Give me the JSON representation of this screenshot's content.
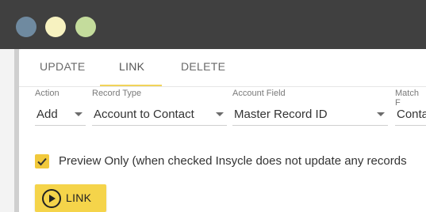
{
  "tabs": [
    {
      "label": "UPDATE"
    },
    {
      "label": "LINK",
      "active": true
    },
    {
      "label": "DELETE"
    }
  ],
  "fields": {
    "action": {
      "label": "Action",
      "value": "Add"
    },
    "record_type": {
      "label": "Record Type",
      "value": "Account to Contact"
    },
    "account_field": {
      "label": "Account Field",
      "value": "Master Record ID"
    },
    "match_field": {
      "label": "Match F",
      "value": "Conta"
    }
  },
  "preview": {
    "checked": true,
    "label": "Preview Only (when checked Insycle does not update any records"
  },
  "action_button": {
    "label": "LINK",
    "icon": "play-circle-icon"
  },
  "window_controls": [
    "close-dot",
    "minimize-dot",
    "maximize-dot"
  ],
  "colors": {
    "accent": "#f5d44a",
    "titlebar": "#404040",
    "dot_blue": "#6f8aa0",
    "dot_yellow": "#f7f2c0",
    "dot_green": "#c4dc9c"
  }
}
